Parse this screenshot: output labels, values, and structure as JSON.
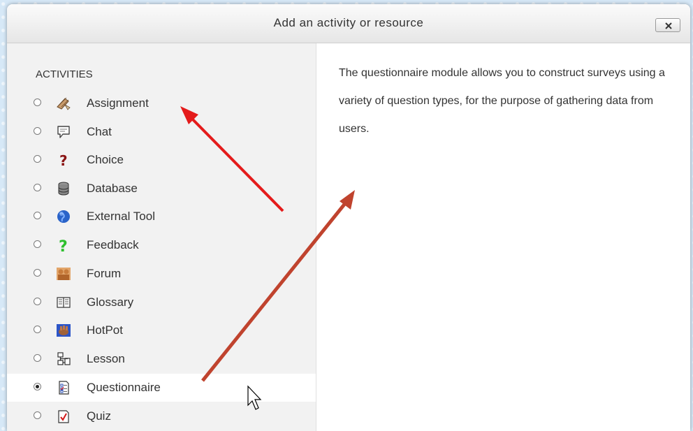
{
  "dialog": {
    "title": "Add an activity or resource",
    "close_icon": "close-icon"
  },
  "activities": {
    "heading": "ACTIVITIES",
    "items": [
      {
        "label": "Assignment",
        "icon": "assignment-icon",
        "selected": false
      },
      {
        "label": "Chat",
        "icon": "chat-icon",
        "selected": false
      },
      {
        "label": "Choice",
        "icon": "choice-icon",
        "selected": false
      },
      {
        "label": "Database",
        "icon": "database-icon",
        "selected": false
      },
      {
        "label": "External Tool",
        "icon": "external-tool-icon",
        "selected": false
      },
      {
        "label": "Feedback",
        "icon": "feedback-icon",
        "selected": false
      },
      {
        "label": "Forum",
        "icon": "forum-icon",
        "selected": false
      },
      {
        "label": "Glossary",
        "icon": "glossary-icon",
        "selected": false
      },
      {
        "label": "HotPot",
        "icon": "hotpot-icon",
        "selected": false
      },
      {
        "label": "Lesson",
        "icon": "lesson-icon",
        "selected": false
      },
      {
        "label": "Questionnaire",
        "icon": "questionnaire-icon",
        "selected": true
      },
      {
        "label": "Quiz",
        "icon": "quiz-icon",
        "selected": false
      }
    ]
  },
  "description": {
    "text": "The questionnaire module allows you to construct surveys using a variety of question types, for the purpose of gathering data from users."
  },
  "colors": {
    "arrow_red": "#e41b1b",
    "arrow_brown": "#c0432e"
  }
}
